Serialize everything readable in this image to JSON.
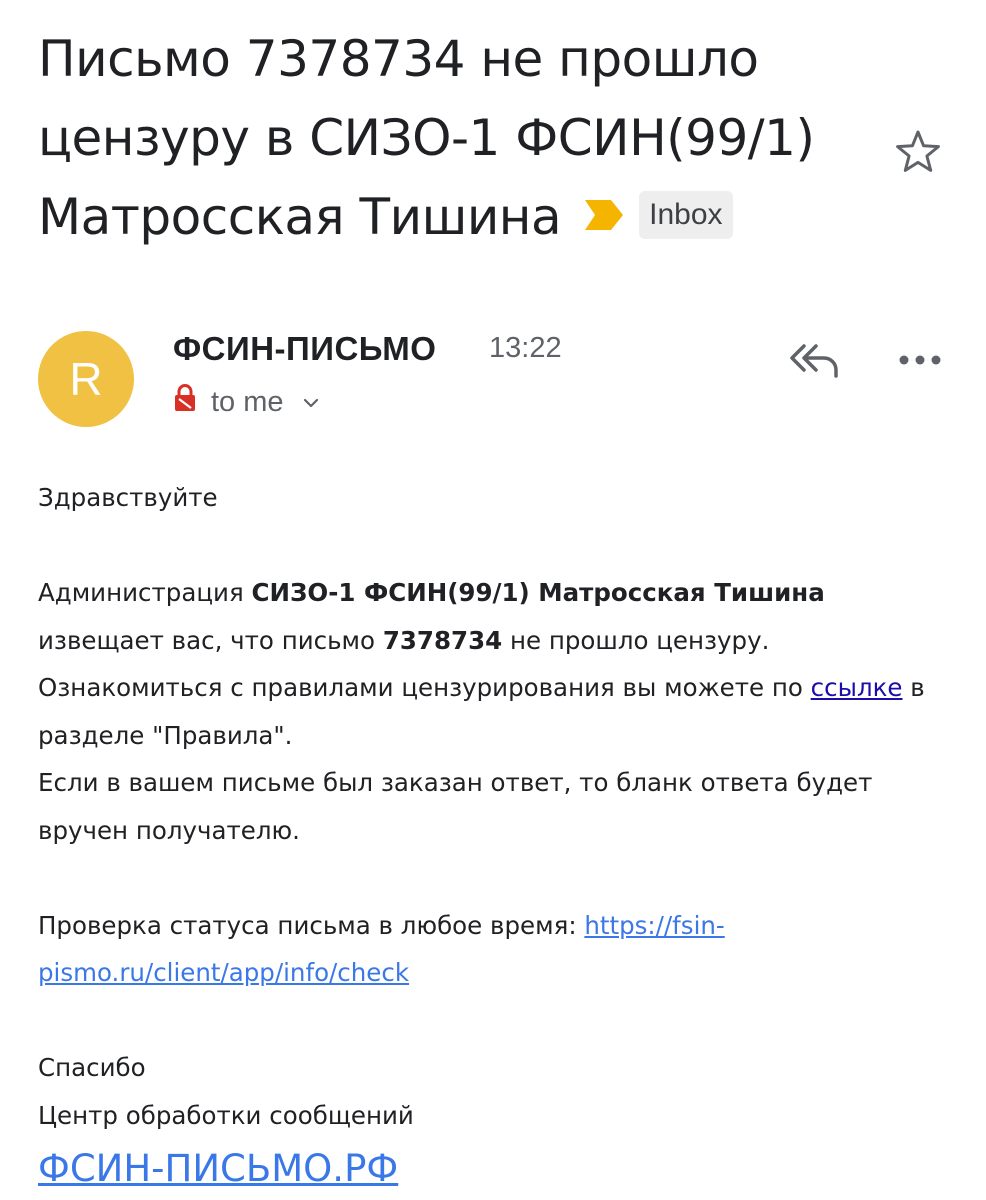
{
  "email": {
    "subject_lines": [
      "Письмо 7378734 не прошло",
      "цензуру в СИЗО-1 ФСИН(99/1)",
      "Матросская Тишина"
    ],
    "label": "Inbox",
    "sender": {
      "initial": "R",
      "name": "ФСИН-ПИСЬМО",
      "time": "13:22",
      "recipient": "to me"
    },
    "body": {
      "greeting": "Здравствуйте",
      "p1_a": "Администрация ",
      "p1_b": "СИЗО-1 ФСИН(99/1) Матросская Тишина",
      "p1_c": " извещает вас, что письмо ",
      "p1_d": "7378734",
      "p1_e": " не прошло цензуру. Ознакомиться с правилами цензурирования вы можете по ",
      "p1_link": "ссылке",
      "p1_f": " в разделе \"Правила\".",
      "p2": "Если в вашем письме был заказан ответ, то бланк ответа будет вручен получателю.",
      "p3_a": "Проверка статуса письма в любое время: ",
      "p3_link": "https://fsin-pismo.ru/client/app/info/check",
      "thanks": "Спасибо",
      "center": "Центр обработки сообщений",
      "site_link": "ФСИН-ПИСЬМО.РФ"
    }
  },
  "colors": {
    "avatar": "#f1c144",
    "importance_marker": "#f4b400",
    "link": "#3b78e7",
    "lock": "#d93025"
  },
  "icons": [
    "star-icon",
    "importance-marker-icon",
    "lock-icon",
    "chevron-down-icon",
    "reply-all-icon",
    "more-icon"
  ]
}
